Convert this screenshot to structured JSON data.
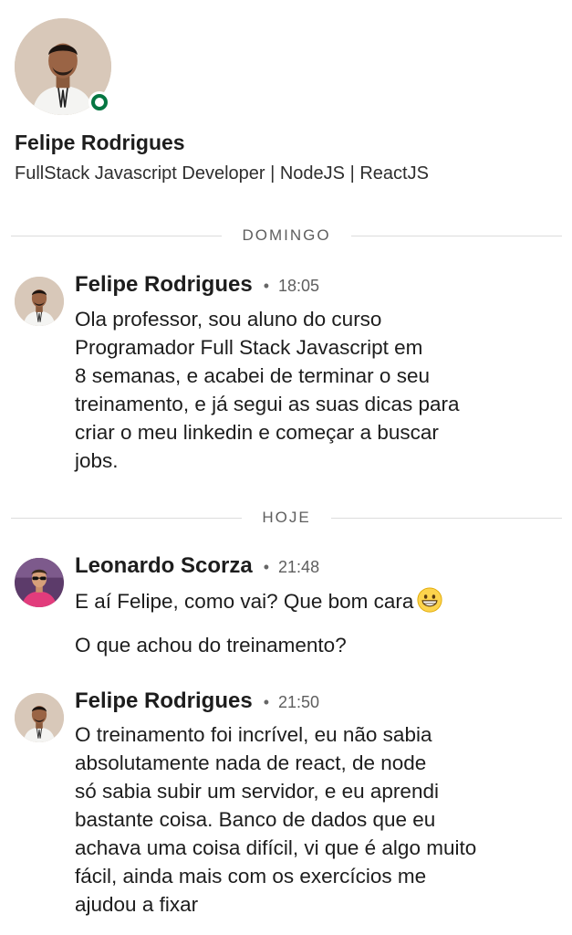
{
  "profile": {
    "name": "Felipe Rodrigues",
    "headline": "FullStack Javascript Developer | NodeJS | ReactJS"
  },
  "dividers": {
    "sunday": "DOMINGO",
    "today": "HOJE"
  },
  "messages": [
    {
      "sender": "Felipe Rodrigues",
      "time": "18:05",
      "lines": [
        "Ola professor, sou aluno do curso",
        "Programador Full Stack Javascript em",
        "8 semanas, e acabei de terminar o seu",
        "treinamento, e já segui as suas dicas para",
        "criar o meu linkedin e começar a buscar",
        "jobs."
      ]
    },
    {
      "sender": "Leonardo Scorza",
      "time": "21:48",
      "text1": "E aí Felipe, como vai? Que bom cara",
      "emoji": "grinning-face-icon",
      "text2": "O que achou do treinamento?"
    },
    {
      "sender": "Felipe Rodrigues",
      "time": "21:50",
      "lines": [
        "O treinamento foi incrível, eu não sabia",
        "absolutamente nada de react, de node",
        "só sabia subir um servidor, e eu aprendi",
        "bastante coisa. Banco de dados que eu",
        "achava uma coisa difícil, vi que é algo muito",
        "fácil, ainda mais com os exercícios me",
        "ajudou a fixar"
      ]
    }
  ],
  "colors": {
    "presence_green": "#057642",
    "divider_line": "#dcdcdc",
    "text_primary": "#1d1d1d",
    "text_secondary": "#5e5e5e"
  },
  "separator": "•"
}
